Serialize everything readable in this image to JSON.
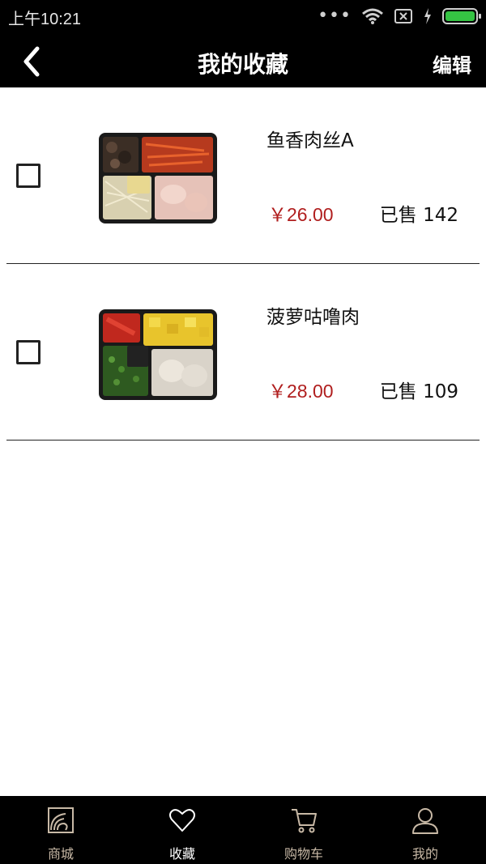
{
  "status": {
    "time": "上午10:21",
    "dots": "•••"
  },
  "nav": {
    "title": "我的收藏",
    "edit_label": "编辑"
  },
  "items": [
    {
      "name": "鱼香肉丝A",
      "price": "￥26.00",
      "sold": "已售 142"
    },
    {
      "name": "菠萝咕噜肉",
      "price": "￥28.00",
      "sold": "已售 109"
    }
  ],
  "tabs": [
    {
      "label": "商城",
      "icon": "shop-icon"
    },
    {
      "label": "收藏",
      "icon": "heart-icon"
    },
    {
      "label": "购物车",
      "icon": "cart-icon"
    },
    {
      "label": "我的",
      "icon": "person-icon"
    }
  ],
  "colors": {
    "accent_price": "#b01e1e",
    "tab_inactive": "#c8b9a6",
    "battery": "#35c443"
  }
}
